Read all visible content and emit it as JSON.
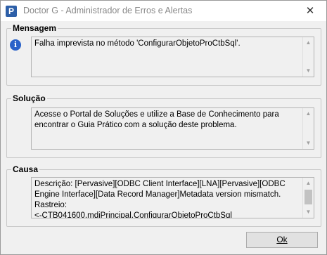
{
  "window": {
    "title": "Doctor G - Administrador de Erros e Alertas",
    "app_icon_glyph": "P",
    "close_glyph": "✕"
  },
  "mensagem": {
    "label": "Mensagem",
    "text": "Falha imprevista no método 'ConfigurarObjetoProCtbSql'.",
    "icon": "info-icon"
  },
  "solucao": {
    "label": "Solução",
    "text": "Acesse o Portal de Soluções e utilize a Base de Conhecimento para encontrar o Guia Prático com a solução deste problema."
  },
  "causa": {
    "label": "Causa",
    "text": "Descrição: [Pervasive][ODBC Client Interface][LNA][Pervasive][ODBC Engine Interface][Data Record Manager]Metadata version mismatch.\nRastreio:\n<-CTB041600.mdiPrincipal.ConfigurarObjetoProCtbSql"
  },
  "ok_button": {
    "label": "Ok"
  },
  "scroll_arrows": {
    "up": "▲",
    "down": "▼"
  },
  "colors": {
    "info_icon": "#2a62c9",
    "app_icon": "#2d5fa8"
  }
}
